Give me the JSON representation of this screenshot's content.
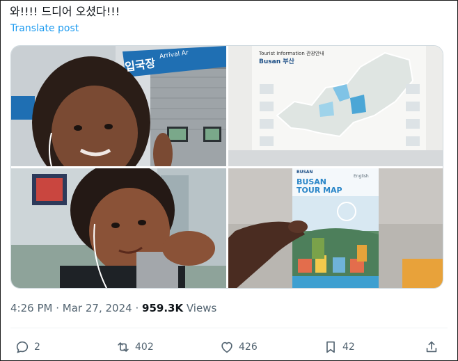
{
  "tweet": {
    "text": "와!!!! 드디어 오셨다!!!",
    "translate_label": "Translate post"
  },
  "media": {
    "sign_arrival": "입국장",
    "sign_arrival_en": "Arrival Ar",
    "map_info": "Tourist Information 관광안내",
    "map_city": "Busan 부산",
    "brochure_brand": "BUSAN",
    "brochure_title": "BUSAN TOUR MAP",
    "brochure_lang": "English"
  },
  "meta": {
    "time": "4:26 PM",
    "separator": "·",
    "date": "Mar 27, 2024",
    "views_count": "959.3K",
    "views_label": "Views"
  },
  "actions": {
    "replies": "2",
    "reposts": "402",
    "likes": "426",
    "bookmarks": "42"
  },
  "colors": {
    "link": "#1d9bf0",
    "muted": "#536471",
    "text": "#0f1419"
  }
}
